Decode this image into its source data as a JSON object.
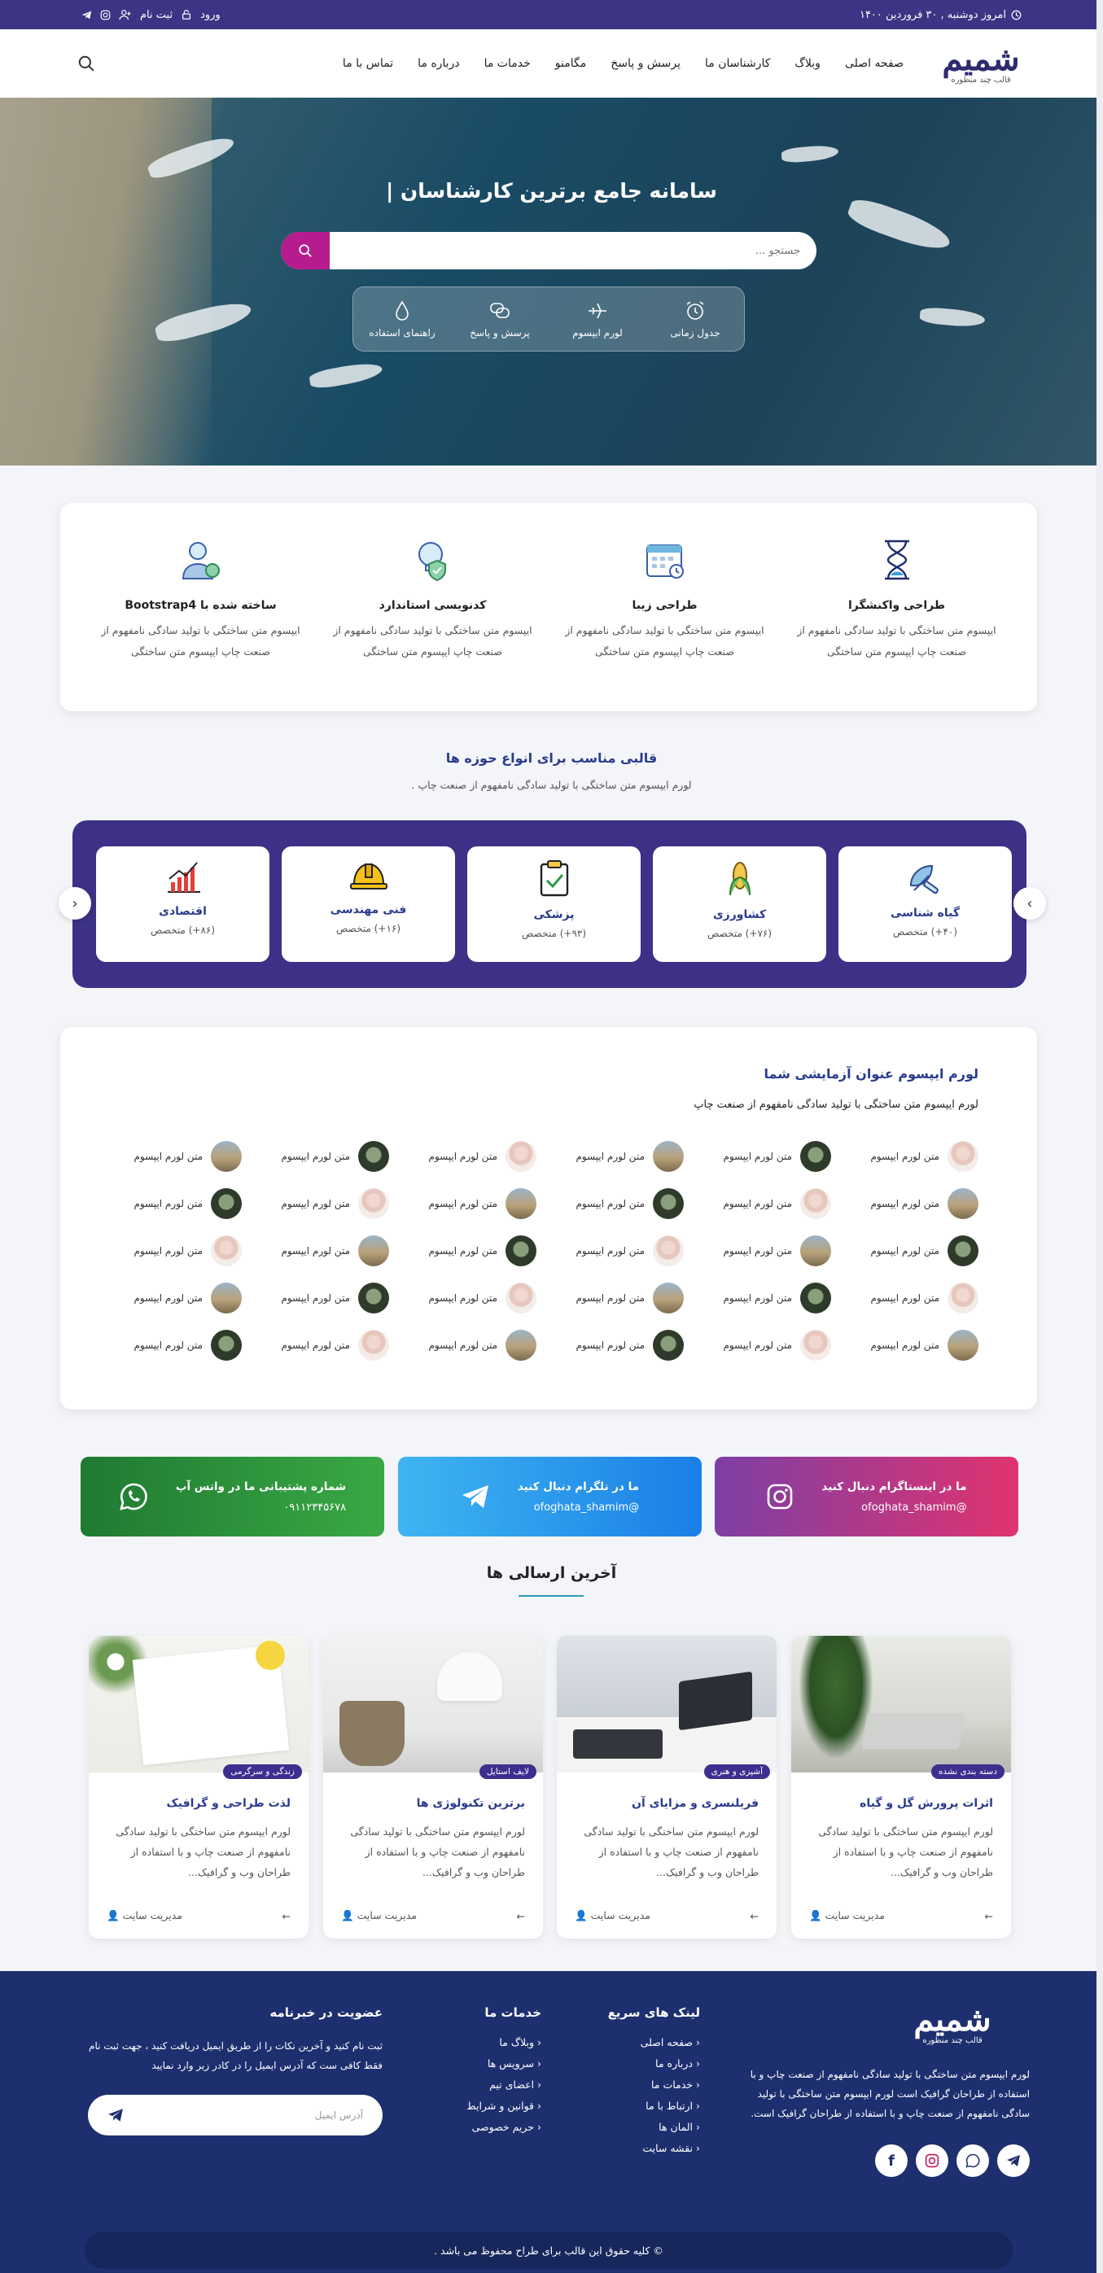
{
  "topbar": {
    "date": "امروز دوشنبه , ۳۰ فروردین ۱۴۰۰",
    "login": "ورود",
    "register": "ثبت نام"
  },
  "navbar": {
    "logo_text": "شمیم",
    "logo_tagline": "قالب چند منظوره",
    "menu": [
      "صفحه اصلی",
      "وبلاگ",
      "کارشناسان ما",
      "پرسش و پاسخ",
      "مگامنو",
      "خدمات ما",
      "درباره ما",
      "تماس با ما"
    ]
  },
  "hero": {
    "title": "سامانه جامع برترین کارشناسان |",
    "search_placeholder": "جستجو ...",
    "quick_links": [
      "جدول زمانی",
      "لورم ایپسوم",
      "پرسش و پاسخ",
      "راهنمای استفاده"
    ]
  },
  "features": [
    {
      "title": "طراحی واکنشگرا",
      "desc": "ایپسوم متن ساختگی با تولید سادگی نامفهوم از صنعت چاپ ایپسوم متن ساختگی"
    },
    {
      "title": "طراحی زیبا",
      "desc": "ایپسوم متن ساختگی با تولید سادگی نامفهوم از صنعت چاپ ایپسوم متن ساختگی"
    },
    {
      "title": "کدنویسی استاندارد",
      "desc": "ایپسوم متن ساختگی با تولید سادگی نامفهوم از صنعت چاپ ایپسوم متن ساختگی"
    },
    {
      "title": "ساخته شده با Bootstrap4",
      "desc": "ایپسوم متن ساختگی با تولید سادگی نامفهوم از صنعت چاپ ایپسوم متن ساختگی"
    }
  ],
  "categories_section": {
    "title": "قالبی مناسب برای انواع حوزه ها",
    "subtitle": "لورم ایپسوم متن ساختگی با تولید سادگی نامفهوم از صنعت چاپ .",
    "items": [
      {
        "name": "گیاه شناسی",
        "count": "(۴۰+) متخصص",
        "icon": "leaf-icon"
      },
      {
        "name": "کشاورزی",
        "count": "(۷۶+) متخصص",
        "icon": "corn-icon"
      },
      {
        "name": "پزشکی",
        "count": "(۹۳+) متخصص",
        "icon": "clipboard-icon"
      },
      {
        "name": "فنی مهندسی",
        "count": "(۱۶+) متخصص",
        "icon": "helmet-icon"
      },
      {
        "name": "اقتصادی",
        "count": "(۸۶+) متخصص",
        "icon": "chart-icon"
      }
    ]
  },
  "grid_section": {
    "title": "لورم ایپسوم عنوان آزمایشی شما",
    "subtitle": "لورم ایپسوم متن ساختگی با تولید سادگی نامفهوم از صنعت چاپ",
    "item_label": "متن لورم ایپسوم"
  },
  "social": [
    {
      "title": "ما در اینستاگرام دنبال کنید",
      "handle": "@ofoghata_shamim",
      "icon": "instagram-icon"
    },
    {
      "title": "ما در تلگرام دنبال کنید",
      "handle": "@ofoghata_shamim",
      "icon": "telegram-icon"
    },
    {
      "title": "شماره پشتیبانی ما در واتس آپ",
      "handle": "۰۹۱۱۲۳۴۵۶۷۸",
      "icon": "whatsapp-icon"
    }
  ],
  "latest": {
    "title": "آخرین ارسالی ها",
    "posts": [
      {
        "badge": "دسته بندی نشده",
        "title": "اثرات پرورش گل و گیاه",
        "excerpt": "لورم ایپسوم متن ساختگی با تولید سادگی نامفهوم از صنعت چاپ و با استفاده از طراحان وب و گرافیک...",
        "author": "مدیریت سایت"
      },
      {
        "badge": "آشپزی و هنری",
        "title": "فریلنسری و مزایای آن",
        "excerpt": "لورم ایپسوم متن ساختگی با تولید سادگی نامفهوم از صنعت چاپ و با استفاده از طراحان وب و گرافیک...",
        "author": "مدیریت سایت"
      },
      {
        "badge": "لایف استایل",
        "title": "برترین تکنولوژی ها",
        "excerpt": "لورم ایپسوم متن ساختگی با تولید سادگی نامفهوم از صنعت چاپ و با استفاده از طراحان وب و گرافیک...",
        "author": "مدیریت سایت"
      },
      {
        "badge": "زندگی و سرگرمی",
        "title": "لذت طراحی و گرافیک",
        "excerpt": "لورم ایپسوم متن ساختگی با تولید سادگی نامفهوم از صنعت چاپ و با استفاده از طراحان وب و گرافیک...",
        "author": "مدیریت سایت"
      }
    ]
  },
  "footer": {
    "about": "لورم ایپسوم متن ساختگی با تولید سادگی نامفهوم از صنعت چاپ و با استفاده از طراحان گرافیک است لورم ایپسوم متن ساختگی با تولید سادگی نامفهوم از صنعت چاپ و با استفاده از طراحان گرافیک است.",
    "quick_links_title": "لینک های سریع",
    "quick_links": [
      "صفحه اصلی",
      "درباره ما",
      "خدمات ما",
      "ارتباط با ما",
      "المان ها",
      "نقشه سایت"
    ],
    "services_title": "خدمات ما",
    "services": [
      "وبلاگ ما",
      "سرویس ها",
      "اعضای تیم",
      "قوانین و شرایط",
      "حریم خصوصی"
    ],
    "newsletter_title": "عضویت در خبرنامه",
    "newsletter_text": "ثبت نام کنید و آخرین نکات را از طریق ایمیل دریافت کنید ، جهت ثبت نام فقط کافی ست که آدرس ایمیل را در کادر زیر وارد نمایید",
    "email_placeholder": "آدرس ایمیل",
    "copyright": "© کلیه حقوق این قالب برای طراح محفوظ می باشد ."
  }
}
